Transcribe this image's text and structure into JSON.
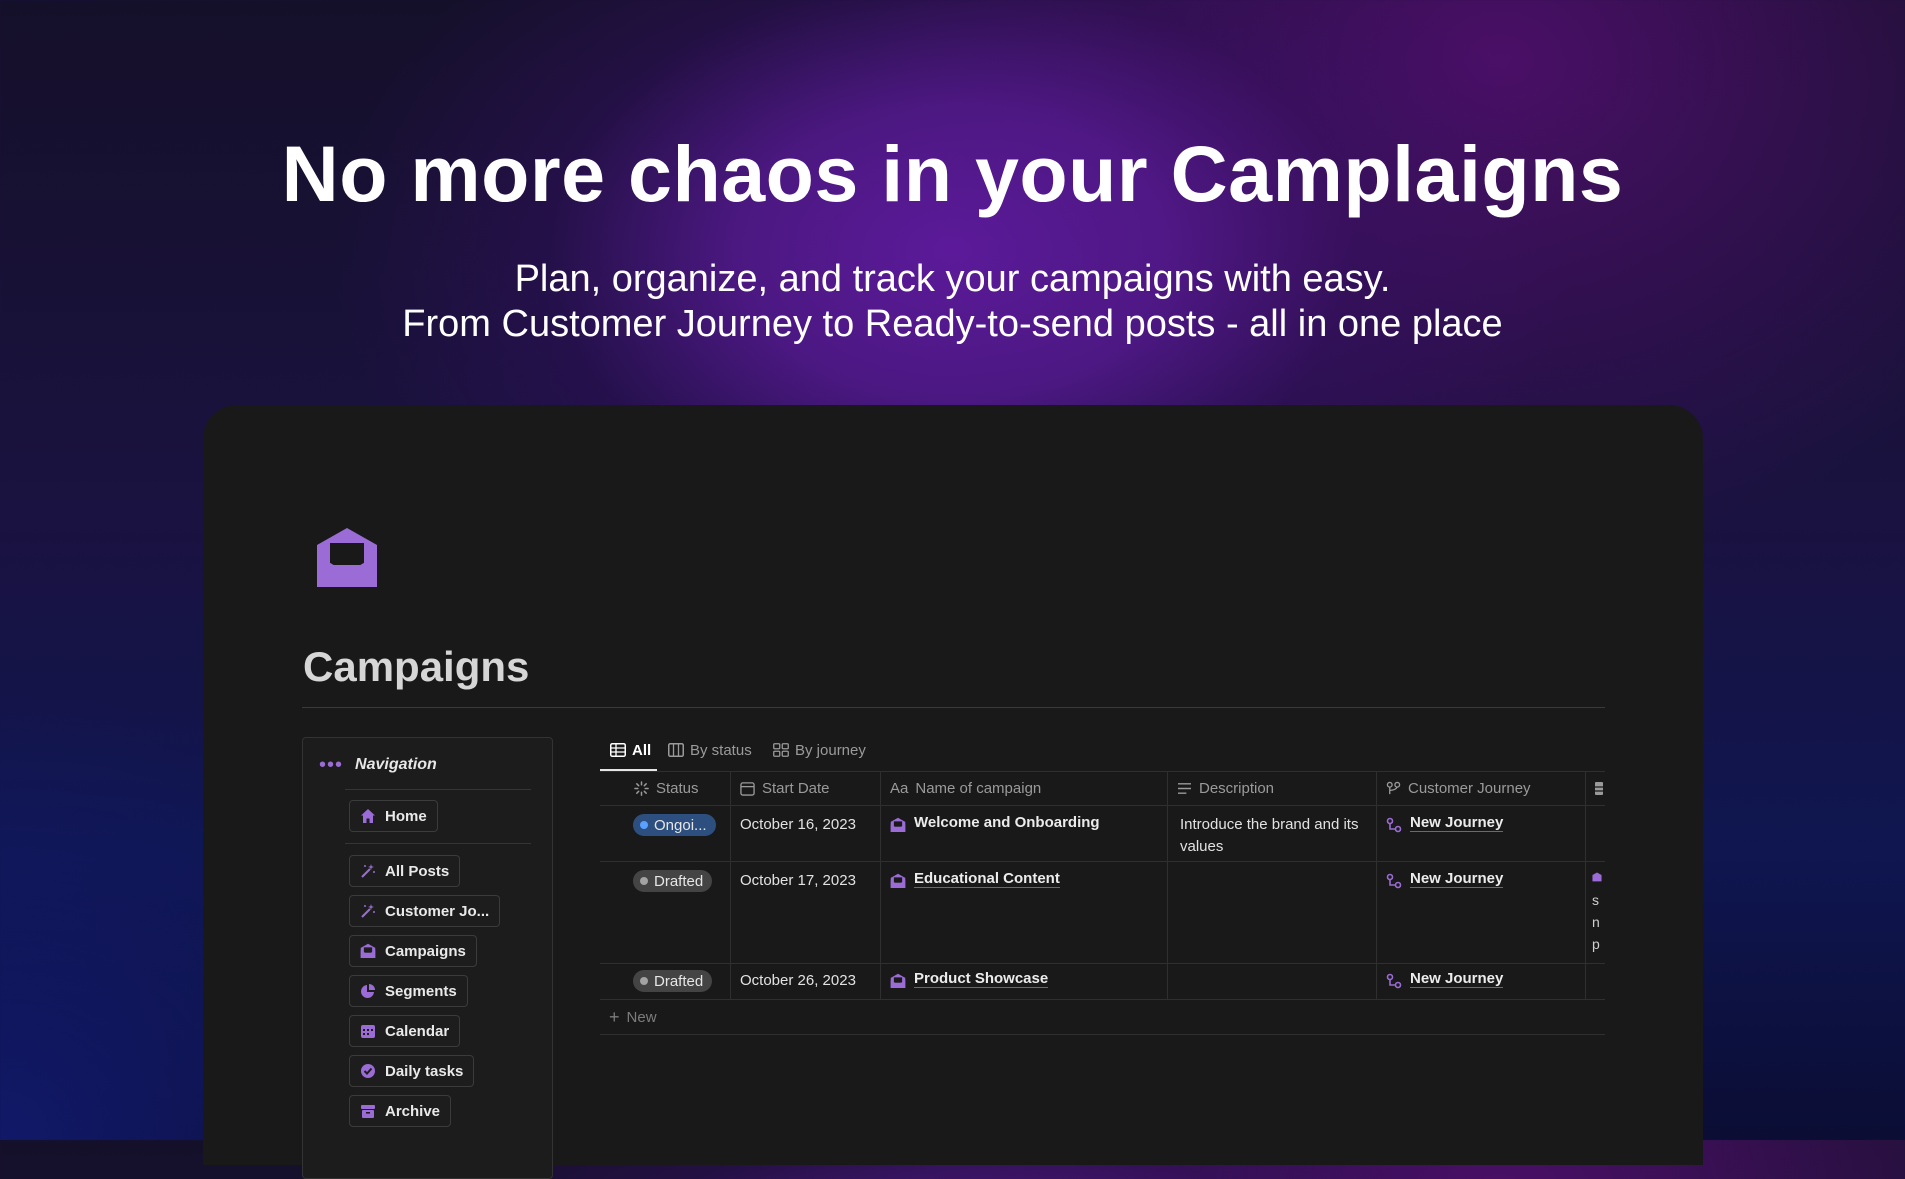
{
  "hero": {
    "title": "No more chaos in your Camplaigns",
    "subtitle_line1": "Plan, organize, and track your campaigns with easy.",
    "subtitle_line2": "From Customer Journey to Ready-to-send posts - all in one place"
  },
  "page": {
    "icon": "envelope-open-icon",
    "title": "Campaigns"
  },
  "navigation": {
    "title": "Navigation",
    "items": [
      {
        "label": "Home",
        "icon": "home-icon"
      },
      {
        "label": "All Posts",
        "icon": "magic-wand-icon"
      },
      {
        "label": "Customer Jo...",
        "icon": "magic-wand-icon"
      },
      {
        "label": "Campaigns",
        "icon": "envelope-open-icon"
      },
      {
        "label": "Segments",
        "icon": "pie-chart-icon"
      },
      {
        "label": "Calendar",
        "icon": "calendar-icon"
      },
      {
        "label": "Daily tasks",
        "icon": "check-circle-icon"
      },
      {
        "label": "Archive",
        "icon": "archive-icon"
      }
    ]
  },
  "views": {
    "tabs": [
      "All",
      "By status",
      "By journey"
    ],
    "active": "All"
  },
  "table": {
    "columns": [
      "Status",
      "Start Date",
      "Name of campaign",
      "Description",
      "Customer Journey"
    ],
    "name_prefix": "Aa",
    "rows": [
      {
        "status": "Ongoi...",
        "date": "October 16, 2023",
        "name": "Welcome and Onboarding",
        "description": "Introduce the brand and its values",
        "journey": "New Journey",
        "extra": ""
      },
      {
        "status": "Drafted",
        "date": "October 17, 2023",
        "name": "Educational Content",
        "description": "",
        "journey": "New Journey",
        "extra": "s\nn\np"
      },
      {
        "status": "Drafted",
        "date": "October 26, 2023",
        "name": "Product Showcase",
        "description": "",
        "journey": "New Journey",
        "extra": ""
      }
    ],
    "new_label": "New"
  },
  "colors": {
    "accent": "#9b6bd6",
    "ongoing": "#2d4f80",
    "drafted": "#444444",
    "panel": "#191919"
  }
}
